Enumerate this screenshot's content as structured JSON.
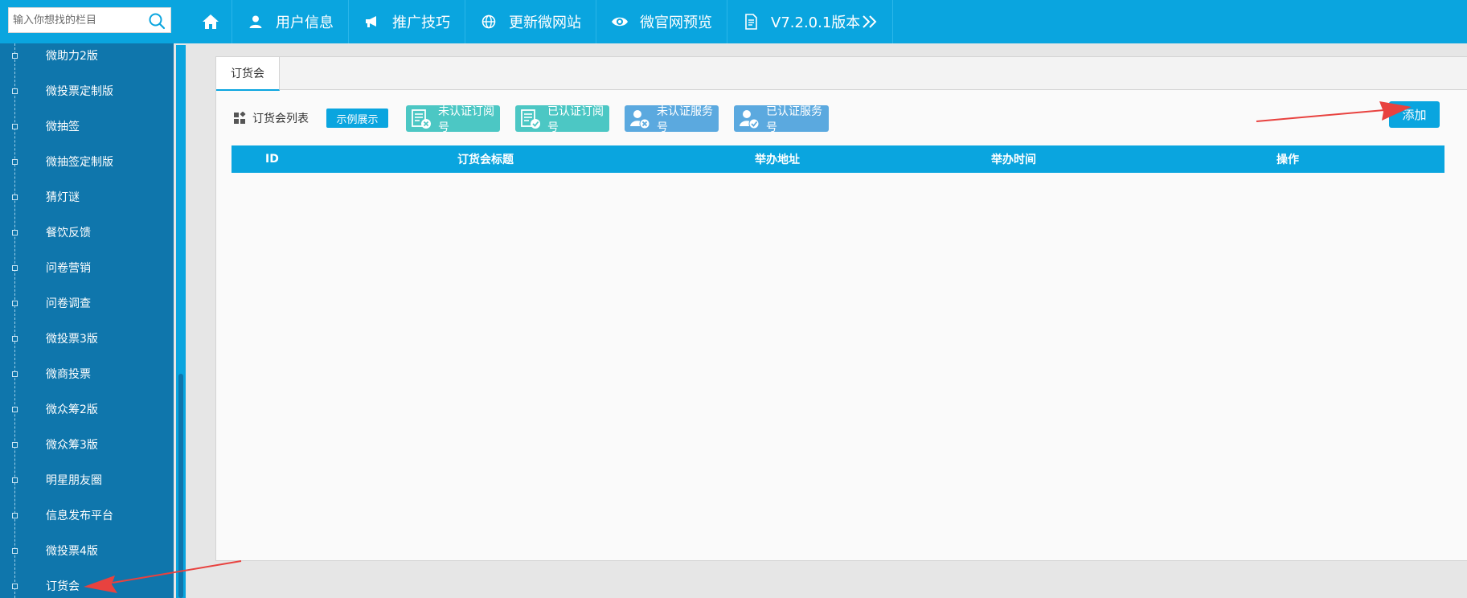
{
  "search": {
    "placeholder": "输入你想找的栏目"
  },
  "topnav": {
    "items": [
      {
        "label": ""
      },
      {
        "label": "用户信息"
      },
      {
        "label": "推广技巧"
      },
      {
        "label": "更新微网站"
      },
      {
        "label": "微官网预览"
      },
      {
        "label": "V7.2.0.1版本"
      }
    ]
  },
  "sidebar": {
    "items": [
      {
        "label": "微助力2版"
      },
      {
        "label": "微投票定制版"
      },
      {
        "label": "微抽签"
      },
      {
        "label": "微抽签定制版"
      },
      {
        "label": "猜灯谜"
      },
      {
        "label": "餐饮反馈"
      },
      {
        "label": "问卷营销"
      },
      {
        "label": "问卷调查"
      },
      {
        "label": "微投票3版"
      },
      {
        "label": "微商投票"
      },
      {
        "label": "微众筹2版"
      },
      {
        "label": "微众筹3版"
      },
      {
        "label": "明星朋友圈"
      },
      {
        "label": "信息发布平台"
      },
      {
        "label": "微投票4版"
      },
      {
        "label": "订货会"
      }
    ]
  },
  "main": {
    "tab": "订货会",
    "list_title": "订货会列表",
    "demo_button": "示例展示",
    "account_buttons": [
      {
        "label": "未认证订阅号"
      },
      {
        "label": "已认证订阅号"
      },
      {
        "label": "未认证服务号"
      },
      {
        "label": "已认证服务号"
      }
    ],
    "add_button": "添加",
    "table": {
      "columns": [
        "ID",
        "订货会标题",
        "举办地址",
        "举办时间",
        "操作"
      ],
      "rows": []
    }
  },
  "colors": {
    "accent": "#0aa5df",
    "sidebar": "#0f76ac",
    "teal_button": "#4cc7c4",
    "blue_button": "#5ba9df",
    "arrow": "#e8423f"
  }
}
